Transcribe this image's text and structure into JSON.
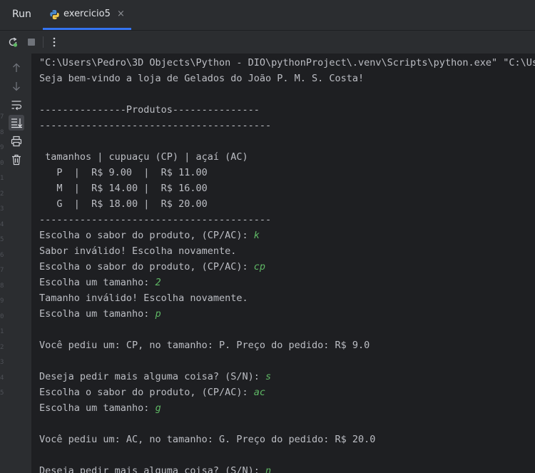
{
  "tabbar": {
    "run_label": "Run",
    "tab_title": "exercicio5",
    "tab_close": "×"
  },
  "gutter_numbers": [
    "7",
    "8",
    "9",
    "0",
    "1",
    "2",
    "3",
    "4",
    "5",
    "6",
    "7",
    "8",
    "9",
    "0",
    "1",
    "2",
    "3",
    "4",
    "5"
  ],
  "console": {
    "lines": [
      {
        "out": "\"C:\\Users\\Pedro\\3D Objects\\Python - DIO\\pythonProject\\.venv\\Scripts\\python.exe\" \"C:\\Use",
        "in": ""
      },
      {
        "out": "Seja bem-vindo a loja de Gelados do João P. M. S. Costa!",
        "in": ""
      },
      {
        "out": "",
        "in": ""
      },
      {
        "out": "---------------Produtos---------------",
        "in": ""
      },
      {
        "out": "----------------------------------------",
        "in": ""
      },
      {
        "out": "",
        "in": ""
      },
      {
        "out": " tamanhos | cupuaçu (CP) | açaí (AC)",
        "in": ""
      },
      {
        "out": "   P  |  R$ 9.00  |  R$ 11.00",
        "in": ""
      },
      {
        "out": "   M  |  R$ 14.00 |  R$ 16.00",
        "in": ""
      },
      {
        "out": "   G  |  R$ 18.00 |  R$ 20.00",
        "in": ""
      },
      {
        "out": "----------------------------------------",
        "in": ""
      },
      {
        "out": "Escolha o sabor do produto, (CP/AC): ",
        "in": "k"
      },
      {
        "out": "Sabor inválido! Escolha novamente.",
        "in": ""
      },
      {
        "out": "Escolha o sabor do produto, (CP/AC): ",
        "in": "cp"
      },
      {
        "out": "Escolha um tamanho: ",
        "in": "2"
      },
      {
        "out": "Tamanho inválido! Escolha novamente.",
        "in": ""
      },
      {
        "out": "Escolha um tamanho: ",
        "in": "p"
      },
      {
        "out": "",
        "in": ""
      },
      {
        "out": "Você pediu um: CP, no tamanho: P. Preço do pedido: R$ 9.0",
        "in": ""
      },
      {
        "out": "",
        "in": ""
      },
      {
        "out": "Deseja pedir mais alguma coisa? (S/N): ",
        "in": "s"
      },
      {
        "out": "Escolha o sabor do produto, (CP/AC): ",
        "in": "ac"
      },
      {
        "out": "Escolha um tamanho: ",
        "in": "g"
      },
      {
        "out": "",
        "in": ""
      },
      {
        "out": "Você pediu um: AC, no tamanho: G. Preço do pedido: R$ 20.0",
        "in": ""
      },
      {
        "out": "",
        "in": ""
      },
      {
        "out": "Deseja pedir mais alguma coisa? (S/N): ",
        "in": "n"
      }
    ]
  },
  "colors": {
    "panel": "#2b2d30",
    "console_bg": "#1e1f22",
    "text": "#bcbec4",
    "user_input": "#5fb865",
    "tab_accent": "#3574f0"
  },
  "icons": {
    "toolbar": [
      "rerun-icon",
      "stop-icon",
      "more-options-icon"
    ],
    "sidebar": [
      "scroll-up-icon",
      "scroll-down-icon",
      "soft-wrap-icon",
      "scroll-to-end-icon",
      "print-icon",
      "clear-all-icon"
    ]
  }
}
